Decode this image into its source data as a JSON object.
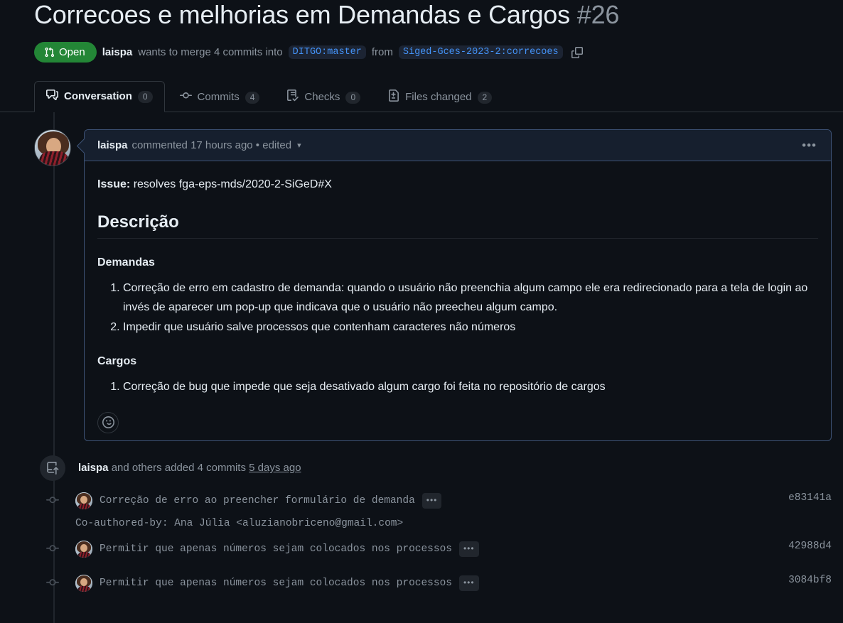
{
  "pr": {
    "title": "Correcoes e melhorias em Demandas e Cargos",
    "number": "#26",
    "state": "Open",
    "author": "laispa",
    "merge_text_1": "wants to merge 4 commits into",
    "base_branch": "DITGO:master",
    "merge_text_2": "from",
    "head_branch": "Siged-Gces-2023-2:correcoes",
    "copy_icon": "copy-icon",
    "state_icon": "git-pull-request-icon",
    "accent_green": "#238636",
    "accent_blue": "#4493f8"
  },
  "tabs": [
    {
      "label": "Conversation",
      "count": "0",
      "icon": "comment-discussion-icon",
      "active": true
    },
    {
      "label": "Commits",
      "count": "4",
      "icon": "git-commit-icon",
      "active": false
    },
    {
      "label": "Checks",
      "count": "0",
      "icon": "checklist-icon",
      "active": false
    },
    {
      "label": "Files changed",
      "count": "2",
      "icon": "file-diff-icon",
      "active": false
    }
  ],
  "comment": {
    "author": "laispa",
    "meta": "commented 17 hours ago • edited",
    "caret_icon": "chevron-down-icon",
    "kebab": "•••",
    "issue_label": "Issue:",
    "issue_value": "resolves fga-eps-mds/2020-2-SiGeD#X",
    "heading": "Descrição",
    "sections": [
      {
        "subheading": "Demandas",
        "items": [
          "Correção de erro em cadastro de demanda: quando o usuário não preenchia algum campo ele era redirecionado para a tela de login ao invés de aparecer um pop-up que indicava que o usuário não preecheu algum campo.",
          "Impedir que usuário salve processos que contenham caracteres não números"
        ]
      },
      {
        "subheading": "Cargos",
        "items": [
          "Correção de bug que impede que seja desativado algum cargo foi feita no repositório de cargos"
        ]
      }
    ],
    "reaction_icon": "smiley-icon"
  },
  "commits_event": {
    "icon": "repo-push-icon",
    "author": "laispa",
    "text": "and others added 4 commits",
    "time": "5 days ago",
    "rows": [
      {
        "message": "Correção de erro ao preencher formulário de demanda",
        "kebab": "•••",
        "sha": "e83141a",
        "coauthor": "Co-authored-by: Ana Júlia <aluzianobriceno@gmail.com>"
      },
      {
        "message": "Permitir que apenas números sejam colocados nos processos",
        "kebab": "•••",
        "sha": "42988d4",
        "coauthor": ""
      },
      {
        "message": "Permitir que apenas números sejam colocados nos processos",
        "kebab": "•••",
        "sha": "3084bf8",
        "coauthor": ""
      }
    ]
  }
}
